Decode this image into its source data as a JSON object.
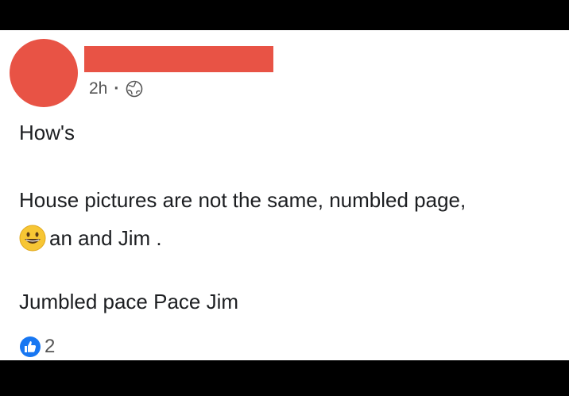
{
  "post": {
    "timestamp": "2h",
    "separator": "·",
    "privacy_icon": "globe-icon",
    "body": {
      "line1": "How's",
      "line2": "House pictures are not the same, numbled page,",
      "line3_emoji": "grinning-face-emoji",
      "line3_text": "an and Jim .",
      "line4": "Jumbled pace  Pace Jim"
    },
    "reactions": {
      "icon": "like-icon",
      "count": "2"
    },
    "colors": {
      "avatar": "#e85345",
      "redaction": "#e85345",
      "like_blue": "#1877f2"
    }
  }
}
